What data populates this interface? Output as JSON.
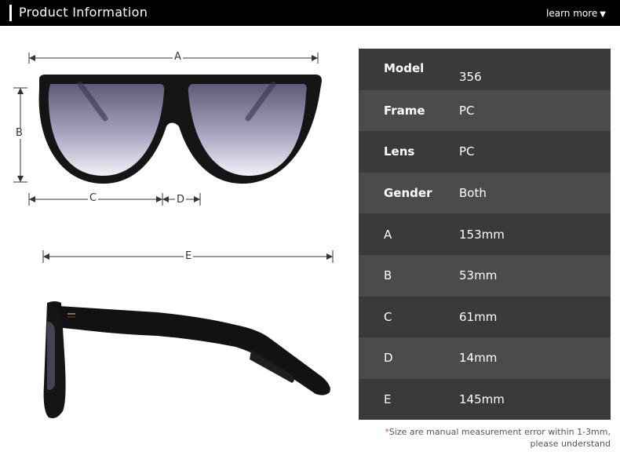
{
  "header": {
    "title": "Product Information",
    "more_label": "learn more",
    "more_icon": "triangle-down-icon"
  },
  "dimensions": {
    "a": "A",
    "b": "B",
    "c": "C",
    "d": "D",
    "e": "E"
  },
  "specs": [
    {
      "key": "Model",
      "value": "356"
    },
    {
      "key": "Frame",
      "value": "PC"
    },
    {
      "key": "Lens",
      "value": "PC"
    },
    {
      "key": "Gender",
      "value": "Both"
    },
    {
      "key": "A",
      "value": "153mm"
    },
    {
      "key": "B",
      "value": "53mm"
    },
    {
      "key": "C",
      "value": "61mm"
    },
    {
      "key": "D",
      "value": "14mm"
    },
    {
      "key": "E",
      "value": "145mm"
    }
  ],
  "note": {
    "line1": "Size are manual measurement error within 1-3mm,",
    "line2": "please understand"
  },
  "colors": {
    "header_bg": "#000000",
    "row_dark": "#3a3a3a",
    "row_light": "#4b4b4b"
  }
}
